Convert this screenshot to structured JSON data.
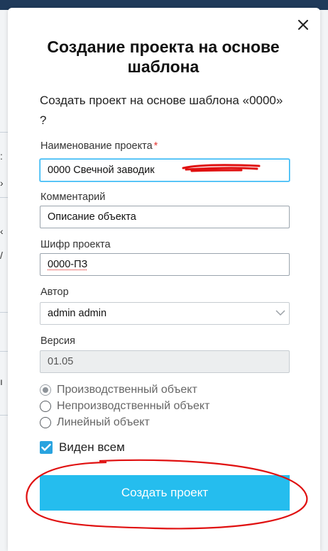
{
  "dialog": {
    "title": "Создание проекта на основе шаблона",
    "question": "Создать проект на основе шаблона «0000» ?",
    "fields": {
      "name": {
        "label": "Наименование проекта",
        "required_mark": "*",
        "value": "0000 Свечной заводик"
      },
      "comment": {
        "label": "Комментарий",
        "value": "Описание объекта"
      },
      "code": {
        "label": "Шифр проекта",
        "value": "0000-ПЗ"
      },
      "author": {
        "label": "Автор",
        "value": "admin admin"
      },
      "version": {
        "label": "Версия",
        "value": "01.05"
      }
    },
    "object_types": [
      {
        "label": "Производственный объект",
        "checked": true
      },
      {
        "label": "Непроизводственный объект",
        "checked": false
      },
      {
        "label": "Линейный объект",
        "checked": false
      }
    ],
    "visible_to_all": {
      "label": "Виден всем",
      "checked": true
    },
    "submit_label": "Создать проект"
  },
  "colors": {
    "primary_button": "#25bdee",
    "checkbox": "#29a3df",
    "focus_border": "#29b6f6",
    "required_mark": "#e53935",
    "annotation_red": "#e01010"
  },
  "icons": {
    "close": "close-icon",
    "select_arrow": "chevron-down-icon",
    "checkbox": "checkmark-icon"
  }
}
